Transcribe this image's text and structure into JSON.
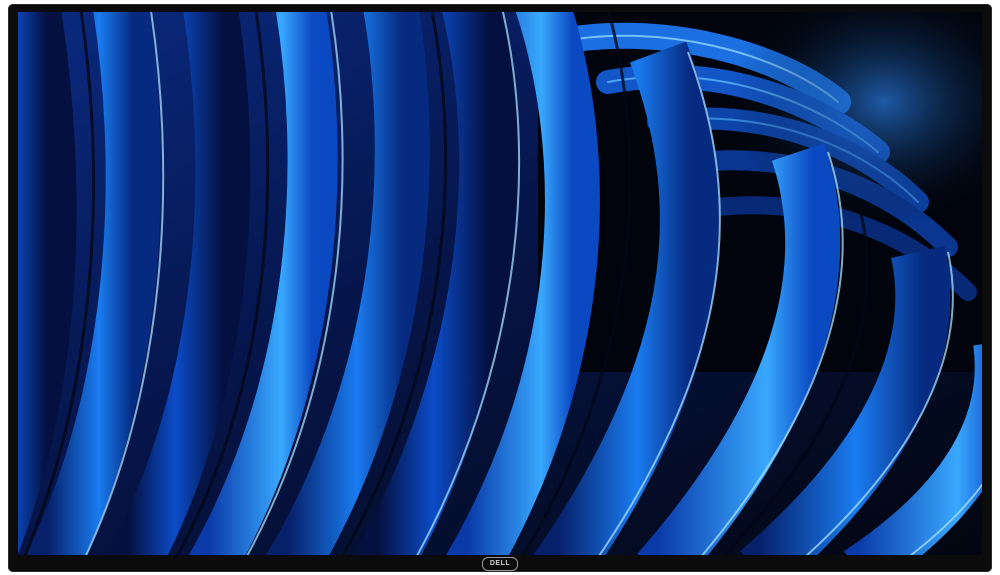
{
  "device": {
    "brand_logo_text": "DELL",
    "bezel_color": "#0b0b0c",
    "logo_color": "#cfcfcf"
  },
  "screen": {
    "content": "abstract-blue-wave-wallpaper",
    "palette": {
      "deep": "#02060f",
      "dark": "#05153d",
      "mid": "#0a3fb0",
      "bright": "#1e8cff",
      "highlight": "#7fd0ff"
    }
  }
}
